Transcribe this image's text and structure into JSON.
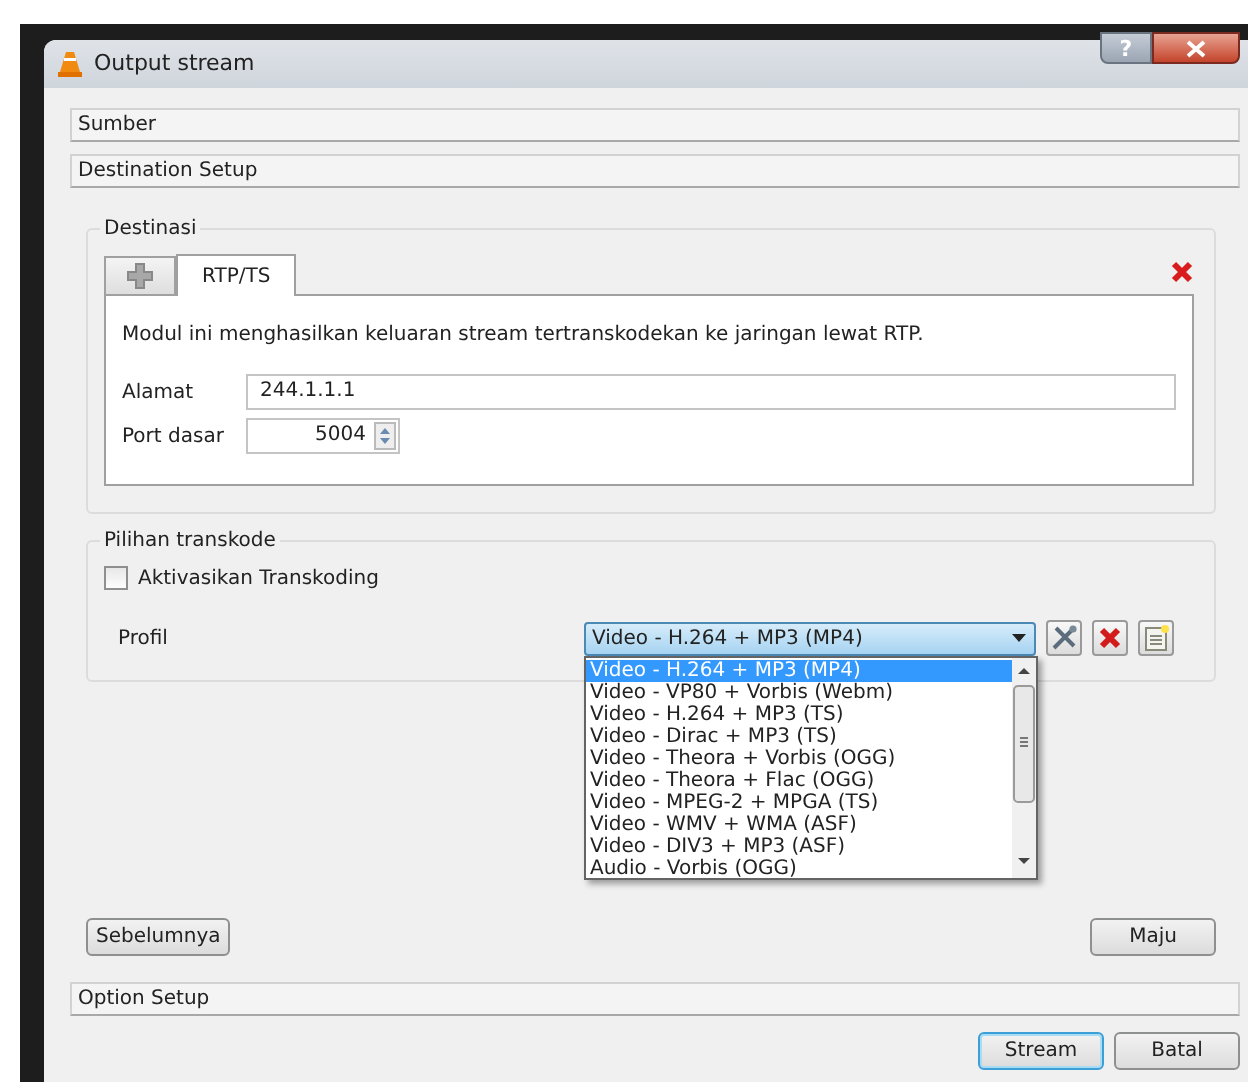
{
  "window": {
    "title": "Output stream",
    "help_label": "?"
  },
  "sections_top": [
    {
      "title": "Sumber"
    },
    {
      "title": "Destination Setup"
    }
  ],
  "destination": {
    "legend": "Destinasi",
    "tabs": [
      {
        "kind": "add",
        "selected": false
      },
      {
        "kind": "text",
        "label": "RTP/TS",
        "selected": true
      }
    ],
    "description": "Modul ini menghasilkan keluaran stream tertranskodekan ke jaringan lewat RTP.",
    "fields": [
      {
        "kind": "text",
        "label": "Alamat",
        "value": "244.1.1.1"
      },
      {
        "kind": "spin",
        "label": "Port dasar",
        "value": "5004"
      }
    ]
  },
  "transcode": {
    "legend": "Pilihan transkode",
    "checkbox": {
      "label": "Aktivasikan Transkoding",
      "checked": false
    },
    "profile": {
      "label": "Profil",
      "value": "Video - H.264 + MP3 (MP4)",
      "expanded": true,
      "options": [
        {
          "label": "Video - H.264 + MP3 (MP4)",
          "selected": true
        },
        {
          "label": "Video - VP80 + Vorbis (Webm)",
          "selected": false
        },
        {
          "label": "Video - H.264 + MP3 (TS)",
          "selected": false
        },
        {
          "label": "Video - Dirac + MP3 (TS)",
          "selected": false
        },
        {
          "label": "Video - Theora + Vorbis (OGG)",
          "selected": false
        },
        {
          "label": "Video - Theora + Flac (OGG)",
          "selected": false
        },
        {
          "label": "Video - MPEG-2 + MPGA (TS)",
          "selected": false
        },
        {
          "label": "Video - WMV + WMA (ASF)",
          "selected": false
        },
        {
          "label": "Video - DIV3 + MP3 (ASF)",
          "selected": false
        },
        {
          "label": "Audio - Vorbis (OGG)",
          "selected": false
        }
      ]
    }
  },
  "nav_buttons": {
    "back": "Sebelumnya",
    "next": "Maju"
  },
  "sections_bottom": [
    {
      "title": "Option Setup"
    }
  ],
  "footer_buttons": [
    {
      "label": "Stream",
      "default": true
    },
    {
      "label": "Batal",
      "default": false
    }
  ]
}
